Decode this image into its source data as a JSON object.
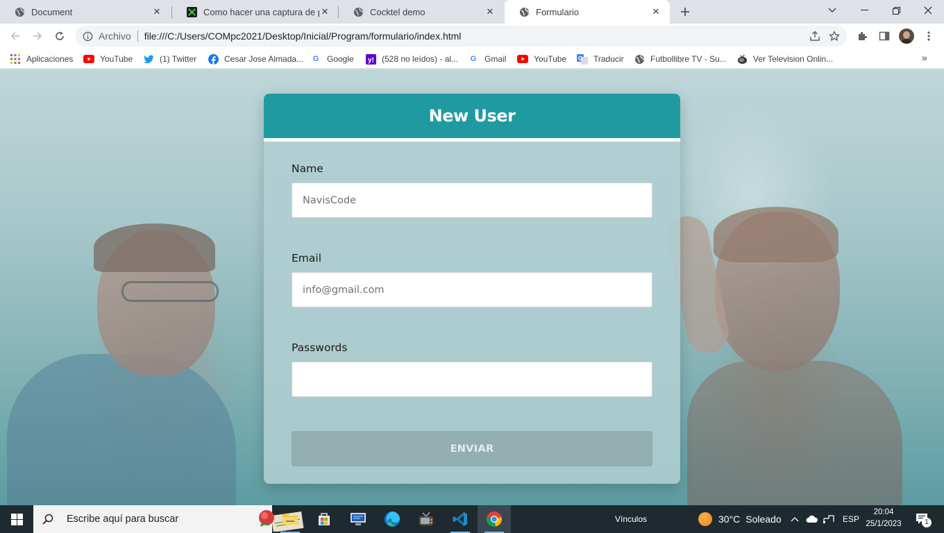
{
  "browser": {
    "tabs": [
      {
        "title": "Document",
        "active": false,
        "icon": "globe-icon"
      },
      {
        "title": "Como hacer una captura de pant",
        "active": false,
        "icon": "snip-app-icon"
      },
      {
        "title": "Cocktel demo",
        "active": false,
        "icon": "globe-icon"
      },
      {
        "title": "Formulario",
        "active": true,
        "icon": "globe-icon"
      }
    ],
    "address": {
      "chip": "Archivo",
      "url": "file:///C:/Users/COMpc2021/Desktop/Inicial/Program/formulario/index.html"
    },
    "bookmarks": [
      {
        "label": "Aplicaciones",
        "icon": "apps-grid-icon"
      },
      {
        "label": "YouTube",
        "icon": "youtube-icon"
      },
      {
        "label": "(1) Twitter",
        "icon": "twitter-icon"
      },
      {
        "label": "Cesar Jose Almada...",
        "icon": "facebook-icon"
      },
      {
        "label": "Google",
        "icon": "google-icon"
      },
      {
        "label": "(528 no leídos) - al...",
        "icon": "yahoo-icon"
      },
      {
        "label": "Gmail",
        "icon": "google-icon"
      },
      {
        "label": "YouTube",
        "icon": "youtube-icon"
      },
      {
        "label": "Traducir",
        "icon": "translate-icon"
      },
      {
        "label": "Futbollibre TV - Su...",
        "icon": "globe-icon"
      },
      {
        "label": "Ver Television Onlin...",
        "icon": "tv-icon"
      }
    ]
  },
  "form": {
    "title": "New User",
    "fields": [
      {
        "label": "Name",
        "placeholder": "NavisCode",
        "value": ""
      },
      {
        "label": "Email",
        "placeholder": "info@gmail.com",
        "value": ""
      },
      {
        "label": "Passwords",
        "placeholder": "",
        "value": ""
      }
    ],
    "submit_label": "ENVIAR"
  },
  "taskbar": {
    "search_placeholder": "Escribe aquí para buscar",
    "links_label": "Vínculos",
    "weather_temp": "30°C",
    "weather_text": "Soleado",
    "language": "ESP",
    "time": "20:04",
    "date": "25/1/2023",
    "notification_count": "1"
  },
  "colors": {
    "header_teal": "#1f9aa1",
    "button_disabled": "#93aeb1",
    "taskbar_bg": "#1f2a30"
  }
}
